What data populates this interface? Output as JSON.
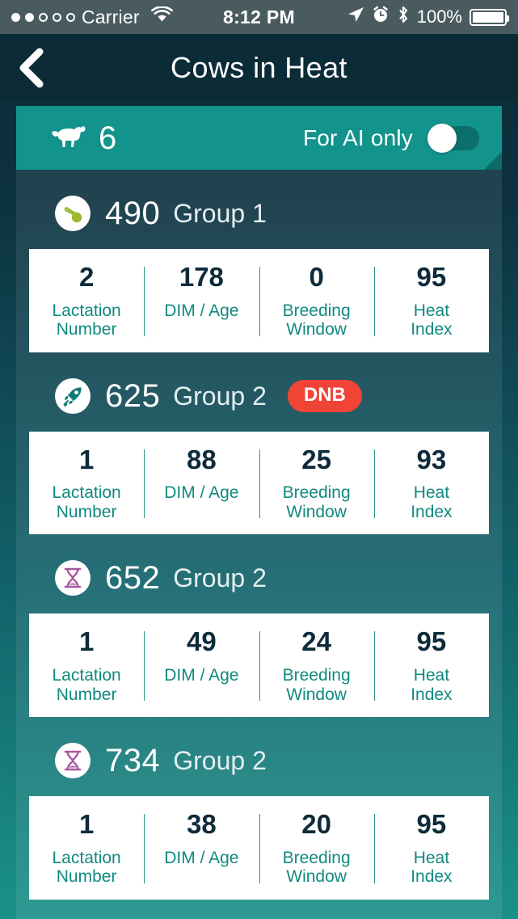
{
  "statusbar": {
    "signal_dots_filled": 2,
    "signal_dots_total": 5,
    "carrier": "Carrier",
    "wifi_icon": "wifi-icon",
    "time": "8:12 PM",
    "location_icon": "location-arrow-icon",
    "alarm_icon": "alarm-clock-icon",
    "bluetooth_icon": "bluetooth-icon",
    "battery_percent": "100%",
    "battery_icon": "battery-full-icon"
  },
  "navbar": {
    "back_icon": "chevron-left-icon",
    "title": "Cows in Heat"
  },
  "ribbon": {
    "cow_icon": "cow-icon",
    "count": "6",
    "ai_label": "For AI only",
    "toggle_state": "off"
  },
  "colors": {
    "ribbon_teal": "#12938c",
    "dnb_red": "#ef4436",
    "stat_value": "#0d2b3a",
    "stat_label": "#10897f",
    "nav_bg": "#0b2b36",
    "sperm_green": "#9bb82e",
    "rocket_teal": "#0f7a74",
    "hourglass_purple": "#a8559c"
  },
  "stat_labels": [
    "Lactation\nNumber",
    "DIM / Age",
    "Breeding\nWindow",
    "Heat\nIndex"
  ],
  "cows": [
    {
      "icon": "sperm-icon",
      "tag": "490",
      "group": "Group 1",
      "badge": null,
      "stats": [
        "2",
        "178",
        "0",
        "95"
      ]
    },
    {
      "icon": "rocket-icon",
      "tag": "625",
      "group": "Group 2",
      "badge": "DNB",
      "stats": [
        "1",
        "88",
        "25",
        "93"
      ]
    },
    {
      "icon": "hourglass-icon",
      "tag": "652",
      "group": "Group 2",
      "badge": null,
      "stats": [
        "1",
        "49",
        "24",
        "95"
      ]
    },
    {
      "icon": "hourglass-icon",
      "tag": "734",
      "group": "Group 2",
      "badge": null,
      "stats": [
        "1",
        "38",
        "20",
        "95"
      ]
    }
  ]
}
